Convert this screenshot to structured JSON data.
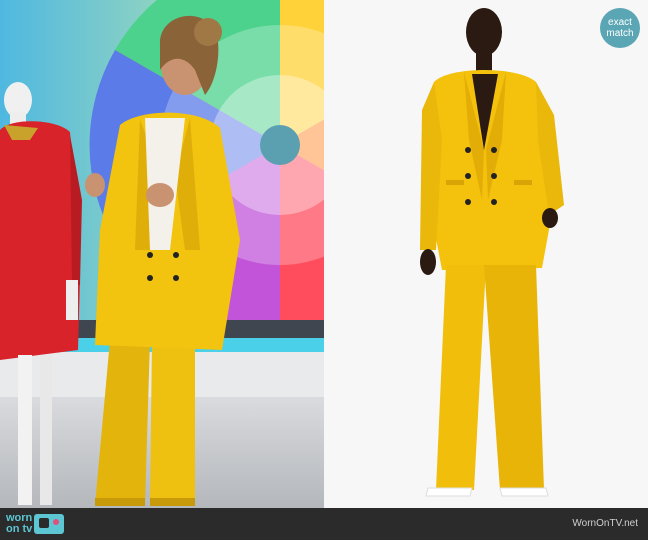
{
  "badge": {
    "line1": "exact",
    "line2": "match"
  },
  "footer": {
    "logo_line1": "worn",
    "logo_line2": "on tv",
    "site": "WornOnTV.net"
  },
  "colors": {
    "suit_yellow": "#f2c30f",
    "badge": "#5aa6b5",
    "footer_bg": "#2b2b2b",
    "logo_teal": "#5cc6d3"
  }
}
